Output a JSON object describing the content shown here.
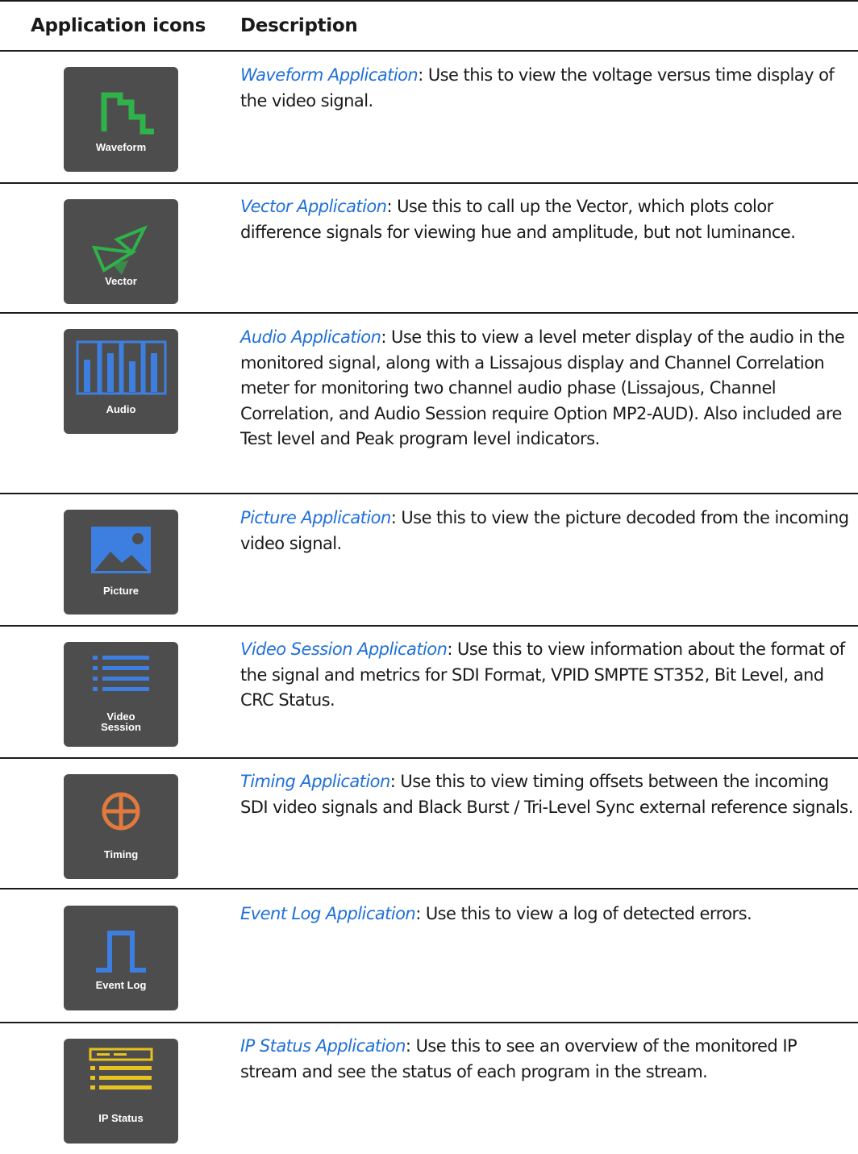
{
  "table": {
    "headers": {
      "icons": "Application icons",
      "description": "Description"
    },
    "rows": [
      {
        "tile_label": "Waveform",
        "icon": "waveform-icon",
        "link": "Waveform Application",
        "text": ": Use this to view the voltage versus time display of the video signal."
      },
      {
        "tile_label": "Vector",
        "icon": "vector-icon",
        "link": "Vector Application",
        "text": ": Use this to call up the Vector, which plots color difference signals for viewing hue and amplitude, but not luminance."
      },
      {
        "tile_label": "Audio",
        "icon": "audio-meter-icon",
        "link": "Audio Application",
        "text": ": Use this to view a level meter display of the audio in the monitored signal, along with a Lissajous display and Channel Correlation meter for monitoring two channel audio phase (Lissajous, Channel Correlation, and Audio Session require Option MP2-AUD). Also included are Test level and Peak program level indicators."
      },
      {
        "tile_label": "Picture",
        "icon": "picture-icon",
        "link": "Picture Application",
        "text": ": Use this to view the picture decoded from the incoming video signal."
      },
      {
        "tile_label_line1": "Video",
        "tile_label_line2": "Session",
        "icon": "list-icon",
        "link": "Video Session Application",
        "text": ": Use this to view information about the format of the signal and metrics for SDI Format, VPID SMPTE ST352, Bit Level, and CRC Status."
      },
      {
        "tile_label": "Timing",
        "icon": "crosshair-icon",
        "link": "Timing Application",
        "text": ": Use this to view timing offsets between the incoming SDI video signals and Black Burst / Tri-Level Sync external reference signals."
      },
      {
        "tile_label": "Event Log",
        "icon": "pulse-icon",
        "link": "Event Log Application",
        "text": ": Use this to view a log of detected errors."
      },
      {
        "tile_label": "IP Status",
        "icon": "ip-status-icon",
        "link": "IP Status Application",
        "text": ": Use this to see an overview of the monitored IP stream and see the status of each program in the stream."
      }
    ]
  },
  "colors": {
    "link": "#2070d8",
    "tile_bg": "#4d4d4d",
    "waveform": "#2fb24a",
    "vector": "#2fb24a",
    "audio": "#3d7fe0",
    "picture": "#3d7fe0",
    "session": "#3d7fe0",
    "timing": "#e07a3e",
    "eventlog": "#3d7fe0",
    "ipstatus": "#e8c21f"
  }
}
